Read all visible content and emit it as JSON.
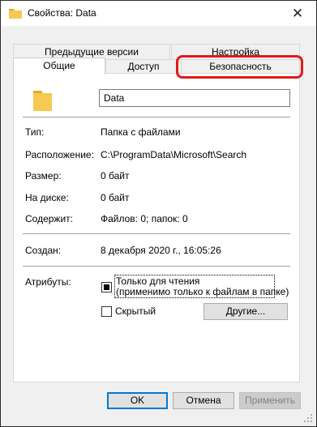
{
  "window": {
    "title": "Свойства: Data",
    "close_glyph": "✕"
  },
  "tabs": {
    "row1": [
      {
        "label": "Предыдущие версии"
      },
      {
        "label": "Настройка"
      }
    ],
    "row2": [
      {
        "label": "Общие",
        "active": true
      },
      {
        "label": "Доступ"
      },
      {
        "label": "Безопасность",
        "highlighted": true
      }
    ]
  },
  "general": {
    "name_value": "Data",
    "type_label": "Тип:",
    "type_value": "Папка с файлами",
    "location_label": "Расположение:",
    "location_value": "C:\\ProgramData\\Microsoft\\Search",
    "size_label": "Размер:",
    "size_value": "0 байт",
    "ondisk_label": "На диске:",
    "ondisk_value": "0 байт",
    "contains_label": "Содержит:",
    "contains_value": "Файлов: 0; папок: 0",
    "created_label": "Создан:",
    "created_value": "8 декабря 2020 г., 16:05:26",
    "attributes_label": "Атрибуты:",
    "readonly_line1": "Только для чтения",
    "readonly_line2": "(применимо только к файлам в папке)",
    "hidden_label": "Скрытый",
    "other_button": "Другие..."
  },
  "footer": {
    "ok": "OK",
    "cancel": "Отмена",
    "apply": "Применить"
  },
  "colors": {
    "highlight": "#e21a1a",
    "folder": "#f6c953",
    "accent": "#0078d7"
  },
  "icons": {
    "title": "folder-icon",
    "large": "folder-icon",
    "close": "close-icon"
  }
}
